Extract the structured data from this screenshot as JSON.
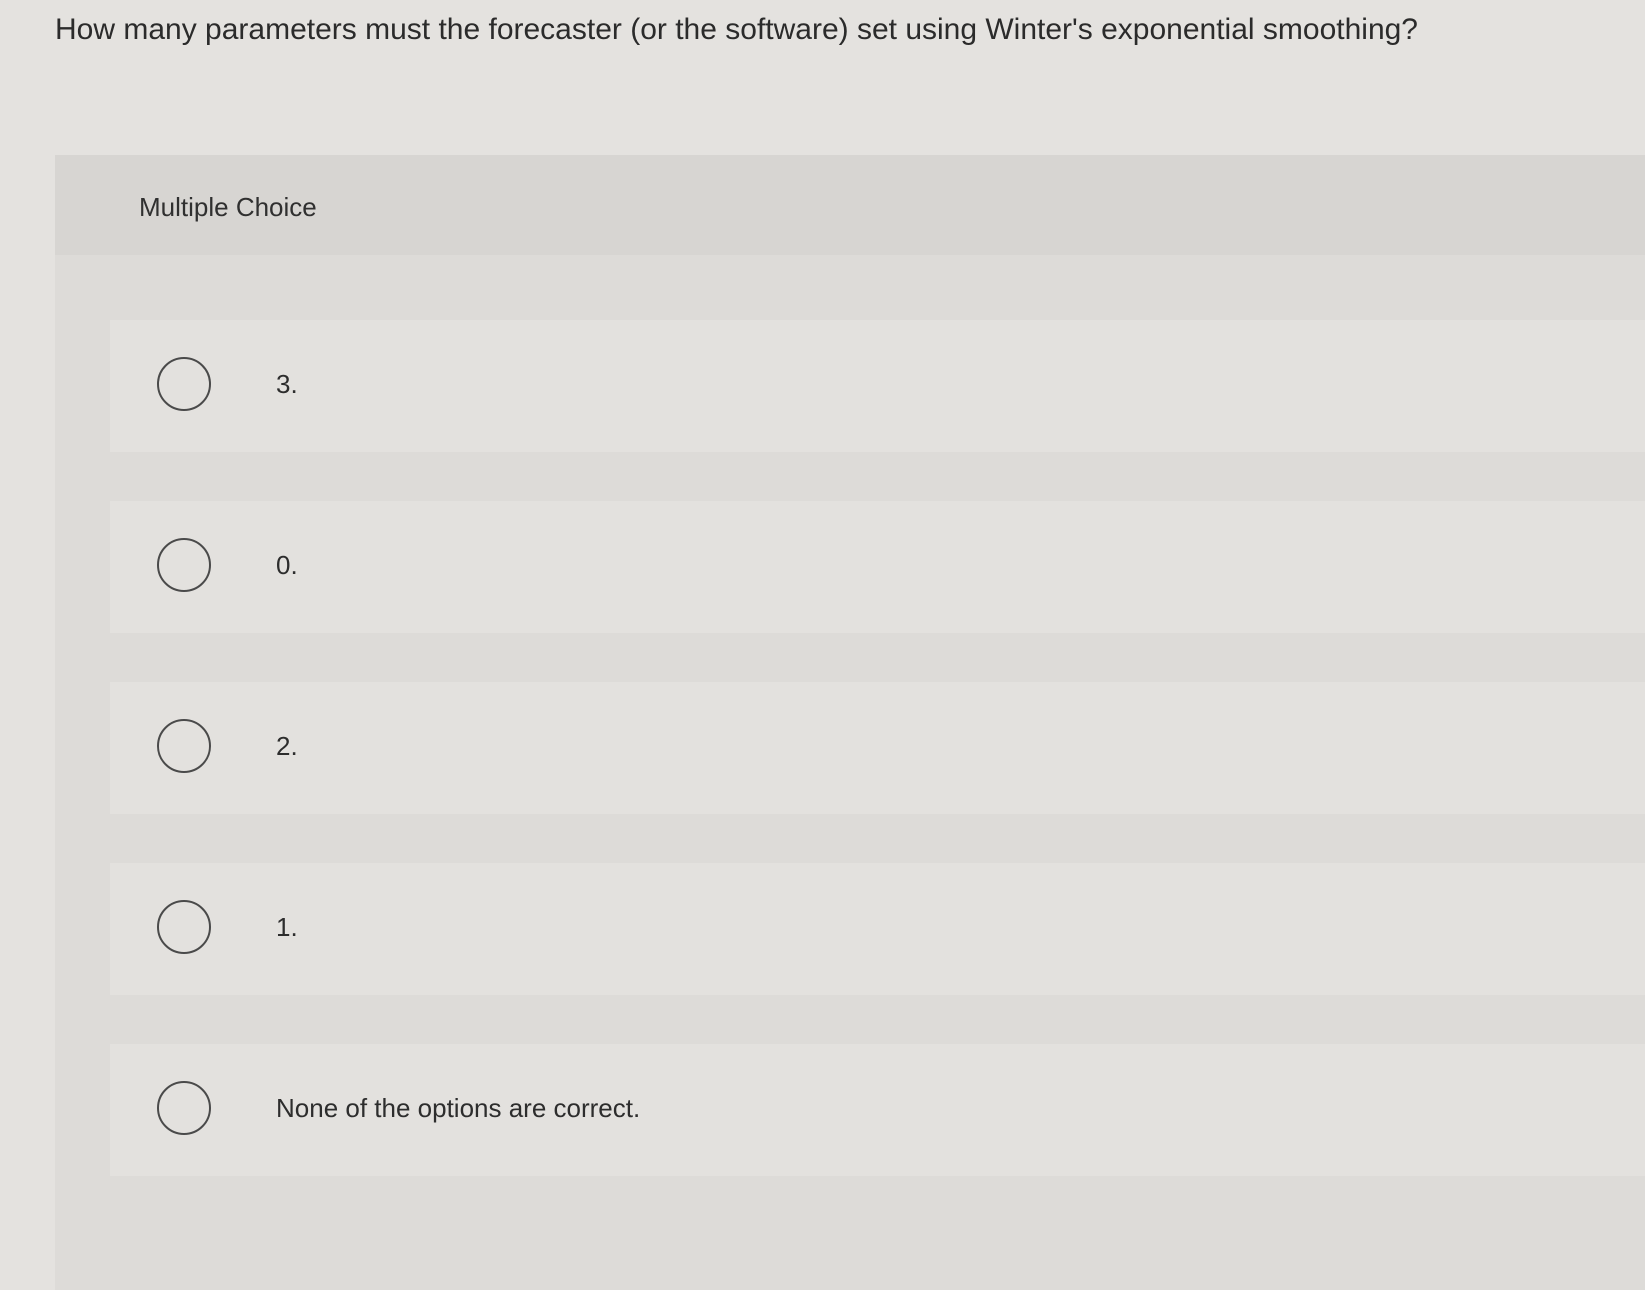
{
  "question": {
    "text": "How many parameters must the forecaster (or the software) set using Winter's exponential smoothing?"
  },
  "panel": {
    "title": "Multiple Choice"
  },
  "options": [
    {
      "label": "3.",
      "icon": "radio-empty"
    },
    {
      "label": "0.",
      "icon": "radio-empty"
    },
    {
      "label": "2.",
      "icon": "radio-empty"
    },
    {
      "label": "1.",
      "icon": "radio-empty"
    },
    {
      "label": "None of the options are correct.",
      "icon": "radio-empty"
    }
  ]
}
